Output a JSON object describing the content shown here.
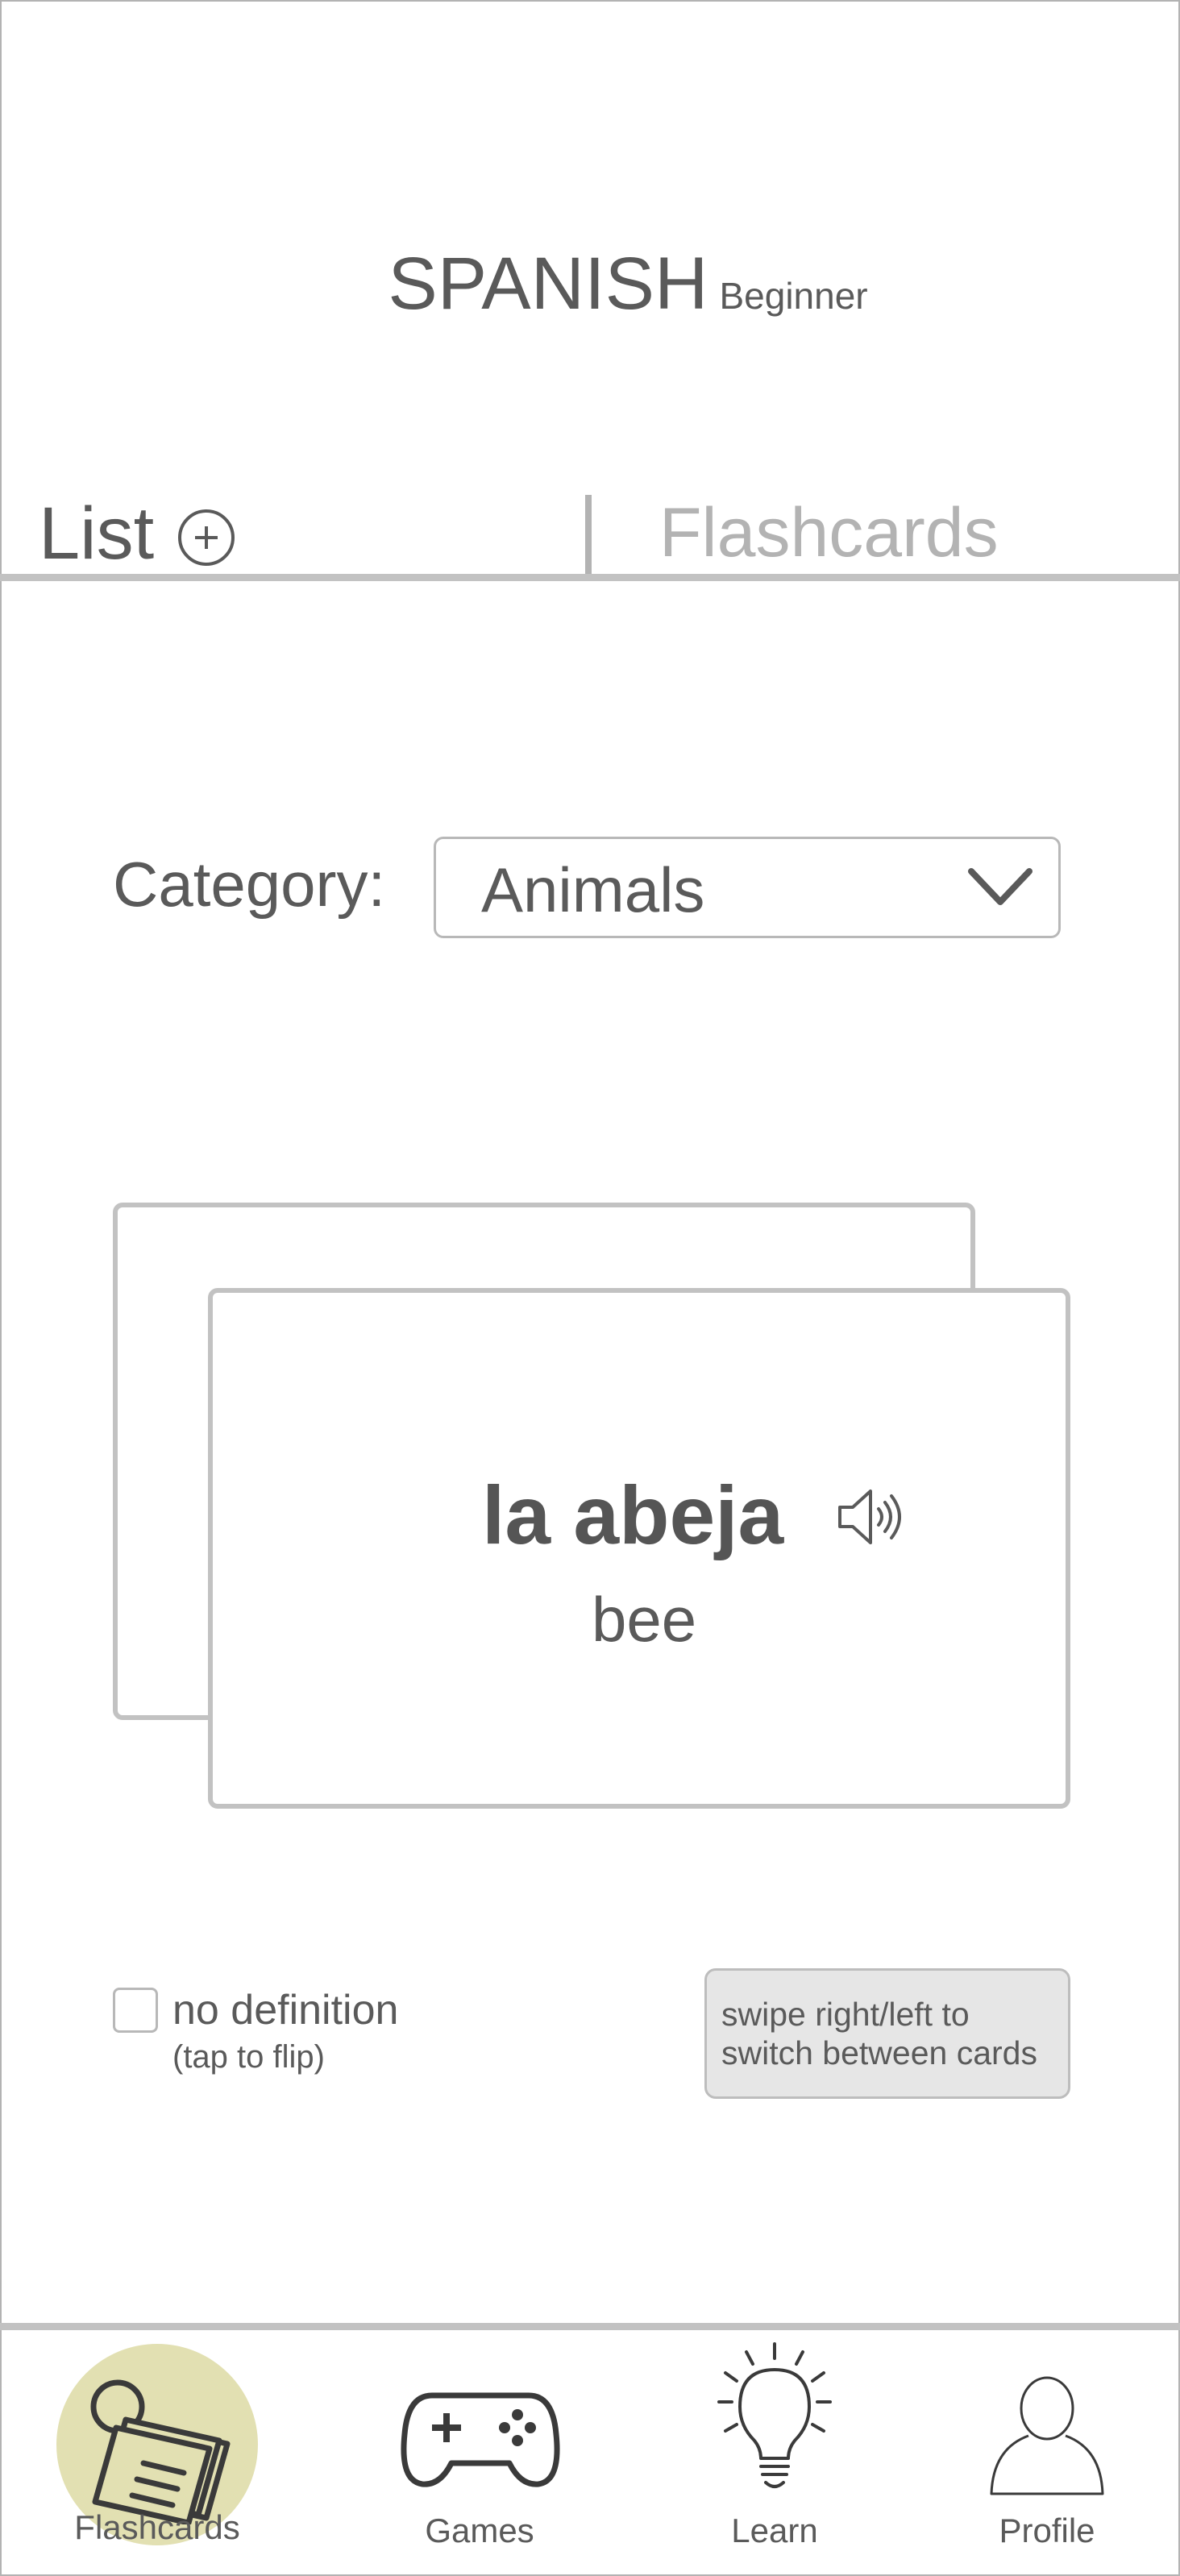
{
  "header": {
    "language": "SPANISH",
    "level": "Beginner"
  },
  "tabs": {
    "list_label": "List",
    "flashcards_label": "Flashcards"
  },
  "category": {
    "label": "Category:",
    "selected": "Animals"
  },
  "card": {
    "word": "la abeja",
    "translation": "bee"
  },
  "options": {
    "no_definition_label": "no definition",
    "no_definition_hint": "(tap to flip)",
    "no_definition_checked": false
  },
  "swipe_hint": {
    "line1": "swipe right/left to",
    "line2": "switch between cards"
  },
  "nav": [
    {
      "label": "Flashcards",
      "icon": "flashcards-icon",
      "active": true
    },
    {
      "label": "Games",
      "icon": "gamepad-icon",
      "active": false
    },
    {
      "label": "Learn",
      "icon": "lightbulb-icon",
      "active": false
    },
    {
      "label": "Profile",
      "icon": "profile-icon",
      "active": false
    }
  ],
  "colors": {
    "active_nav_bg": "#e2e0b2",
    "text": "#5a5a5a",
    "muted": "#b3b3b3",
    "hint_bg": "#e6e6e6"
  }
}
